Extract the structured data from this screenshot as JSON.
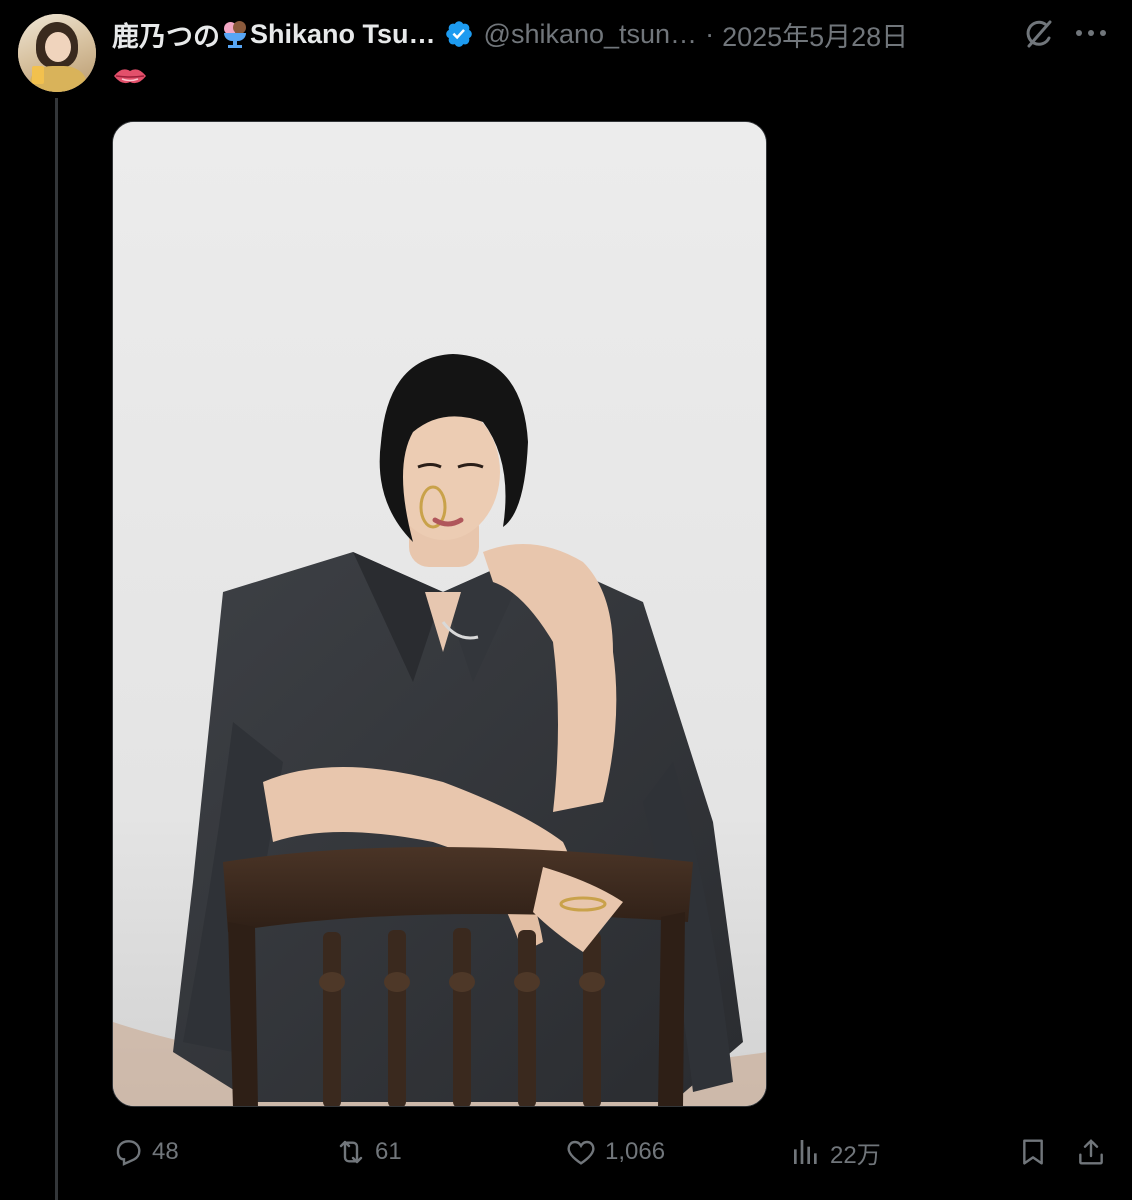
{
  "tweet": {
    "author_name": "鹿乃つの",
    "author_name_suffix": "Shikano Tsu…",
    "handle": "@shikano_tsun…",
    "separator": "·",
    "date": "2025年5月28日",
    "verified": true,
    "text_emoji": "lips-emoji",
    "media_alt": "photo-woman-seated-on-wooden-chair"
  },
  "actions": {
    "replies": "48",
    "retweets": "61",
    "likes": "1,066",
    "views": "22万"
  },
  "colors": {
    "background": "#000000",
    "primary_text": "#e7e9ea",
    "secondary_text": "#71767b",
    "verified_blue": "#1d9bf0",
    "thread_line": "#333639"
  },
  "icons": {
    "reply": "reply-icon",
    "retweet": "retweet-icon",
    "like": "heart-icon",
    "views": "views-bar-chart-icon",
    "bookmark": "bookmark-icon",
    "share": "share-icon",
    "grok": "grok-icon",
    "more": "more-dots-icon"
  }
}
